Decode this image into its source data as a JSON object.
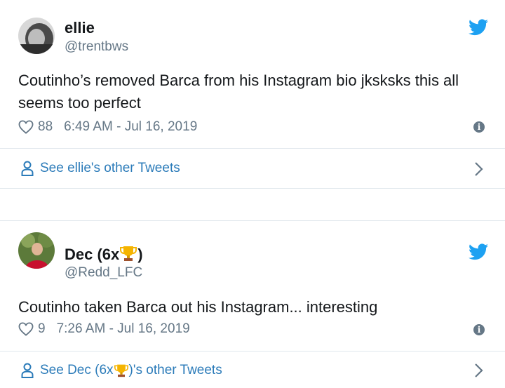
{
  "colors": {
    "name": "#14171a",
    "muted": "#657786",
    "link": "#2b7bb9",
    "twitter_blue": "#1da1f2",
    "divider": "#e1e8ed"
  },
  "tweets": [
    {
      "name": "ellie",
      "handle": "@trentbws",
      "text": "Coutinho’s removed Barca from his Instagram bio jksksks this all seems too perfect",
      "likes": "88",
      "timestamp": "6:49 AM - Jul 16, 2019",
      "other_tweets_label": "See ellie's other Tweets",
      "icons": [
        "avatar",
        "twitter-bird-icon",
        "heart-icon",
        "info-icon",
        "person-icon",
        "chevron-right-icon"
      ]
    },
    {
      "name_prefix": "Dec (6x",
      "name_suffix": ")",
      "handle": "@Redd_LFC",
      "text": "Coutinho taken Barca out his Instagram... interesting",
      "likes": "9",
      "timestamp": "7:26 AM - Jul 16, 2019",
      "other_tweets_prefix": "See Dec (6x",
      "other_tweets_suffix": ")'s other Tweets",
      "icons": [
        "avatar",
        "trophy-icon",
        "twitter-bird-icon",
        "heart-icon",
        "info-icon",
        "person-icon",
        "chevron-right-icon"
      ]
    }
  ]
}
